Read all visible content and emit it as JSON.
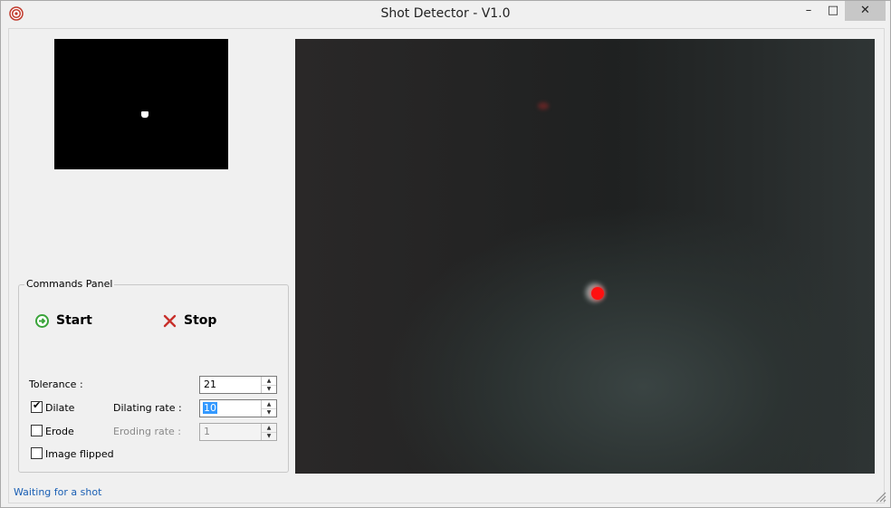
{
  "window": {
    "title": "Shot Detector - V1.0",
    "app_icon": "target-icon"
  },
  "titlebar_buttons": {
    "minimize": "–",
    "maximize": "□",
    "close": "✕"
  },
  "commands_panel": {
    "title": "Commands Panel",
    "start_label": "Start",
    "stop_label": "Stop",
    "tolerance_label": "Tolerance :",
    "tolerance_value": "21",
    "dilate_label": "Dilate",
    "dilate_checked": true,
    "dilating_rate_label": "Dilating rate :",
    "dilating_rate_value": "10",
    "erode_label": "Erode",
    "erode_checked": false,
    "eroding_rate_label": "Eroding rate :",
    "eroding_rate_value": "1",
    "image_flipped_label": "Image flipped",
    "image_flipped_checked": false
  },
  "status": {
    "text": "Waiting for a shot"
  },
  "colors": {
    "status_text": "#1a5fb4",
    "start_icon": "#3aa43a",
    "stop_icon": "#c8302b",
    "laser": "#ff1010"
  }
}
